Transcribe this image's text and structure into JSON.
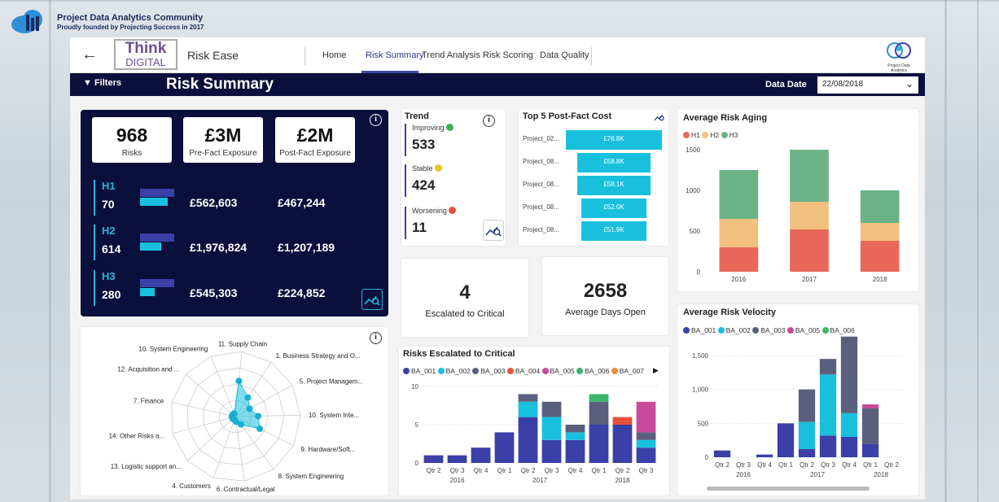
{
  "org": {
    "title": "Project Data Analytics Community",
    "subtitle": "Proudly founded by Projecting Success in 2017"
  },
  "header": {
    "back_icon": "back-arrow-icon",
    "brand_line1": "Think",
    "brand_line2": "DIGITAL",
    "app_name": "Risk Ease",
    "tabs": [
      {
        "label": "Home",
        "active": false
      },
      {
        "label": "Risk Summary",
        "active": true
      },
      {
        "label": "Trend Analysis",
        "active": false
      },
      {
        "label": "Risk Scoring",
        "active": false
      },
      {
        "label": "Data Quality",
        "active": false
      }
    ],
    "logo_caption": "Project Data Analytics Community"
  },
  "titlebar": {
    "filters_label": "Filters",
    "page_title": "Risk Summary",
    "date_label": "Data Date",
    "date_value": "22/08/2018"
  },
  "kpis": [
    {
      "value": "968",
      "label": "Risks"
    },
    {
      "value": "£3M",
      "label": "Pre-Fact Exposure"
    },
    {
      "value": "£2M",
      "label": "Post-Fact Exposure"
    }
  ],
  "horizons": [
    {
      "name": "H1",
      "count": "70",
      "pre": "£562,603",
      "post": "£467,244",
      "bar_pre": 0.72,
      "bar_post": 0.58
    },
    {
      "name": "H2",
      "count": "614",
      "pre": "£1,976,824",
      "post": "£1,207,189",
      "bar_pre": 0.72,
      "bar_post": 0.44
    },
    {
      "name": "H3",
      "count": "280",
      "pre": "£545,303",
      "post": "£224,852",
      "bar_pre": 0.72,
      "bar_post": 0.3
    }
  ],
  "trend": {
    "title": "Trend",
    "items": [
      {
        "label": "Improving",
        "value": "533",
        "color": "#3cb44b"
      },
      {
        "label": "Stable",
        "value": "424",
        "color": "#f0c419"
      },
      {
        "label": "Worsening",
        "value": "11",
        "color": "#e8503a"
      }
    ]
  },
  "top5": {
    "title": "Top 5 Post-Fact Cost",
    "items": [
      {
        "label": "Project_02...",
        "value": "£76.8K",
        "amount": 76.8
      },
      {
        "label": "Project_08...",
        "value": "£58.8K",
        "amount": 58.8
      },
      {
        "label": "Project_08...",
        "value": "£58.1K",
        "amount": 58.1
      },
      {
        "label": "Project_08...",
        "value": "£52.0K",
        "amount": 52.0
      },
      {
        "label": "Project_08...",
        "value": "£51.9K",
        "amount": 51.9
      }
    ]
  },
  "escalated_card": {
    "value": "4",
    "label": "Escalated to Critical"
  },
  "days_card": {
    "value": "2658",
    "label": "Average Days Open"
  },
  "colors": {
    "navy": "#0b0f3b",
    "cyan": "#19c0de",
    "accent": "#3b3fa8"
  },
  "chart_data": [
    {
      "type": "bar",
      "title": "Average Risk Aging",
      "categories": [
        "2016",
        "2017",
        "2018"
      ],
      "stacked": true,
      "series": [
        {
          "name": "H1",
          "color": "#e8685a",
          "values": [
            300,
            520,
            380
          ]
        },
        {
          "name": "H2",
          "color": "#f2c07e",
          "values": [
            350,
            340,
            220
          ]
        },
        {
          "name": "H3",
          "color": "#6bb386",
          "values": [
            600,
            640,
            400
          ]
        }
      ],
      "yticks": [
        "0",
        "500",
        "1000",
        "1500"
      ],
      "ylim": [
        0,
        1500
      ],
      "legend": "top-left"
    },
    {
      "type": "bar",
      "title": "Average Risk Velocity",
      "stacked": true,
      "categories": [
        "Qtr 2",
        "Qtr 3",
        "Qtr 4",
        "Qtr 1",
        "Qtr 2",
        "Qtr 3",
        "Qtr 4",
        "Qtr 1",
        "Qtr 2"
      ],
      "years": [
        {
          "label": "2016",
          "cats": [
            0,
            2
          ]
        },
        {
          "label": "2017",
          "cats": [
            3,
            6
          ]
        },
        {
          "label": "2018",
          "cats": [
            7,
            8
          ]
        }
      ],
      "series": [
        {
          "name": "BA_001",
          "color": "#3b3fa8",
          "values": [
            100,
            0,
            40,
            500,
            120,
            320,
            300,
            200,
            0
          ]
        },
        {
          "name": "BA_002",
          "color": "#19c0de",
          "values": [
            0,
            0,
            0,
            0,
            400,
            900,
            350,
            0,
            0
          ]
        },
        {
          "name": "BA_003",
          "color": "#5b5f7e",
          "values": [
            0,
            0,
            0,
            0,
            480,
            230,
            1130,
            520,
            0
          ]
        },
        {
          "name": "BA_005",
          "color": "#c84a9c",
          "values": [
            0,
            0,
            0,
            0,
            0,
            0,
            0,
            60,
            0
          ]
        },
        {
          "name": "BA_006",
          "color": "#3cb46e",
          "values": [
            0,
            0,
            0,
            0,
            0,
            0,
            0,
            0,
            0
          ]
        }
      ],
      "yticks": [
        "0",
        "500",
        "1,000",
        "1,500"
      ],
      "ylim": [
        0,
        1800
      ],
      "legend": "top-left"
    },
    {
      "type": "bar",
      "title": "Risks Escalated to Critical",
      "stacked": true,
      "categories": [
        "Qtr 2",
        "Qtr 3",
        "Qtr 4",
        "Qtr 1",
        "Qtr 2",
        "Qtr 3",
        "Qtr 4",
        "Qtr 1",
        "Qtr 2",
        "Qtr 3"
      ],
      "years": [
        {
          "label": "2016",
          "cats": [
            0,
            2
          ]
        },
        {
          "label": "2017",
          "cats": [
            3,
            6
          ]
        },
        {
          "label": "2018",
          "cats": [
            7,
            9
          ]
        }
      ],
      "series": [
        {
          "name": "BA_001",
          "color": "#3b3fa8",
          "values": [
            1,
            1,
            2,
            4,
            6,
            3,
            3,
            5,
            5,
            2
          ]
        },
        {
          "name": "BA_002",
          "color": "#19c0de",
          "values": [
            0,
            0,
            0,
            0,
            2,
            3,
            1,
            0,
            0,
            1
          ]
        },
        {
          "name": "BA_003",
          "color": "#5b5f7e",
          "values": [
            0,
            0,
            0,
            0,
            1,
            2,
            1,
            3,
            0,
            1
          ]
        },
        {
          "name": "BA_004",
          "color": "#e8503a",
          "values": [
            0,
            0,
            0,
            0,
            0,
            0,
            0,
            0,
            1,
            0
          ]
        },
        {
          "name": "BA_005",
          "color": "#c84a9c",
          "values": [
            0,
            0,
            0,
            0,
            0,
            0,
            0,
            0,
            0,
            4
          ]
        },
        {
          "name": "BA_006",
          "color": "#3cb46e",
          "values": [
            0,
            0,
            0,
            0,
            0,
            0,
            0,
            1,
            0,
            0
          ]
        },
        {
          "name": "BA_007",
          "color": "#f08c3a",
          "values": [
            0,
            0,
            0,
            0,
            0,
            0,
            0,
            0,
            0,
            0
          ]
        }
      ],
      "yticks": [
        "0",
        "5",
        "10"
      ],
      "ylim": [
        0,
        10
      ],
      "legend": "top-left"
    },
    {
      "type": "radar",
      "categories": [
        "11. Supply Chain",
        "1. Business Strategy and O...",
        "5. Project Managem...",
        "10. System Inte...",
        "9. Hardware/Soft...",
        "8. System Engineering",
        "6. Contractual/Legal",
        "4. Customers",
        "13. Logistic support an...",
        "14. Other Risks a...",
        "7. Finance",
        "12. Acquisition and ...",
        "10. System Engineering"
      ],
      "values": [
        0.55,
        0.35,
        0.25,
        0.35,
        0.42,
        0.15,
        0.08,
        0.05,
        0.05,
        0.05,
        0.05,
        0.05,
        0.05
      ]
    }
  ]
}
